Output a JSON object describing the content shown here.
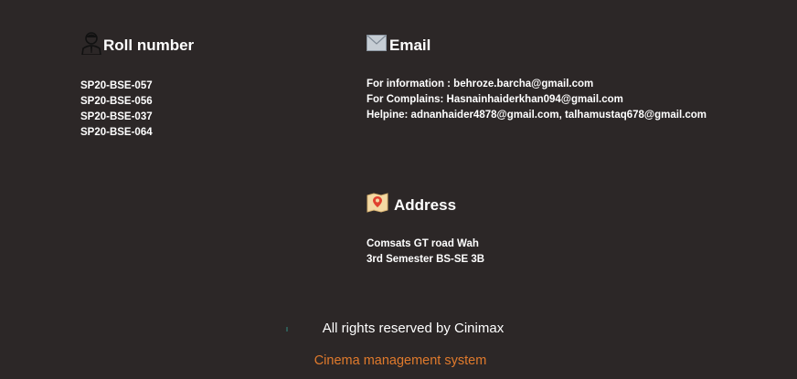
{
  "roll": {
    "title": "Roll number",
    "icon": "person-icon",
    "items": [
      "SP20-BSE-057",
      "SP20-BSE-056",
      "SP20-BSE-037",
      "SP20-BSE-064"
    ]
  },
  "email": {
    "title": "Email",
    "icon": "envelope-icon",
    "lines": [
      "For information : behroze.barcha@gmail.com",
      "For Complains: Hasnainhaiderkhan094@gmail.com",
      "Helpine: adnanhaider4878@gmail.com, talhamustaq678@gmail.com"
    ]
  },
  "address": {
    "title": "Address",
    "icon": "map-pin-icon",
    "lines": [
      "Comsats GT road Wah",
      "3rd Semester BS-SE 3B"
    ]
  },
  "footer": {
    "rights": "All rights reserved by Cinimax",
    "system": "Cinema management system"
  },
  "colors": {
    "background": "#2c2727",
    "text": "#ffffff",
    "accent": "#e07a2c"
  }
}
